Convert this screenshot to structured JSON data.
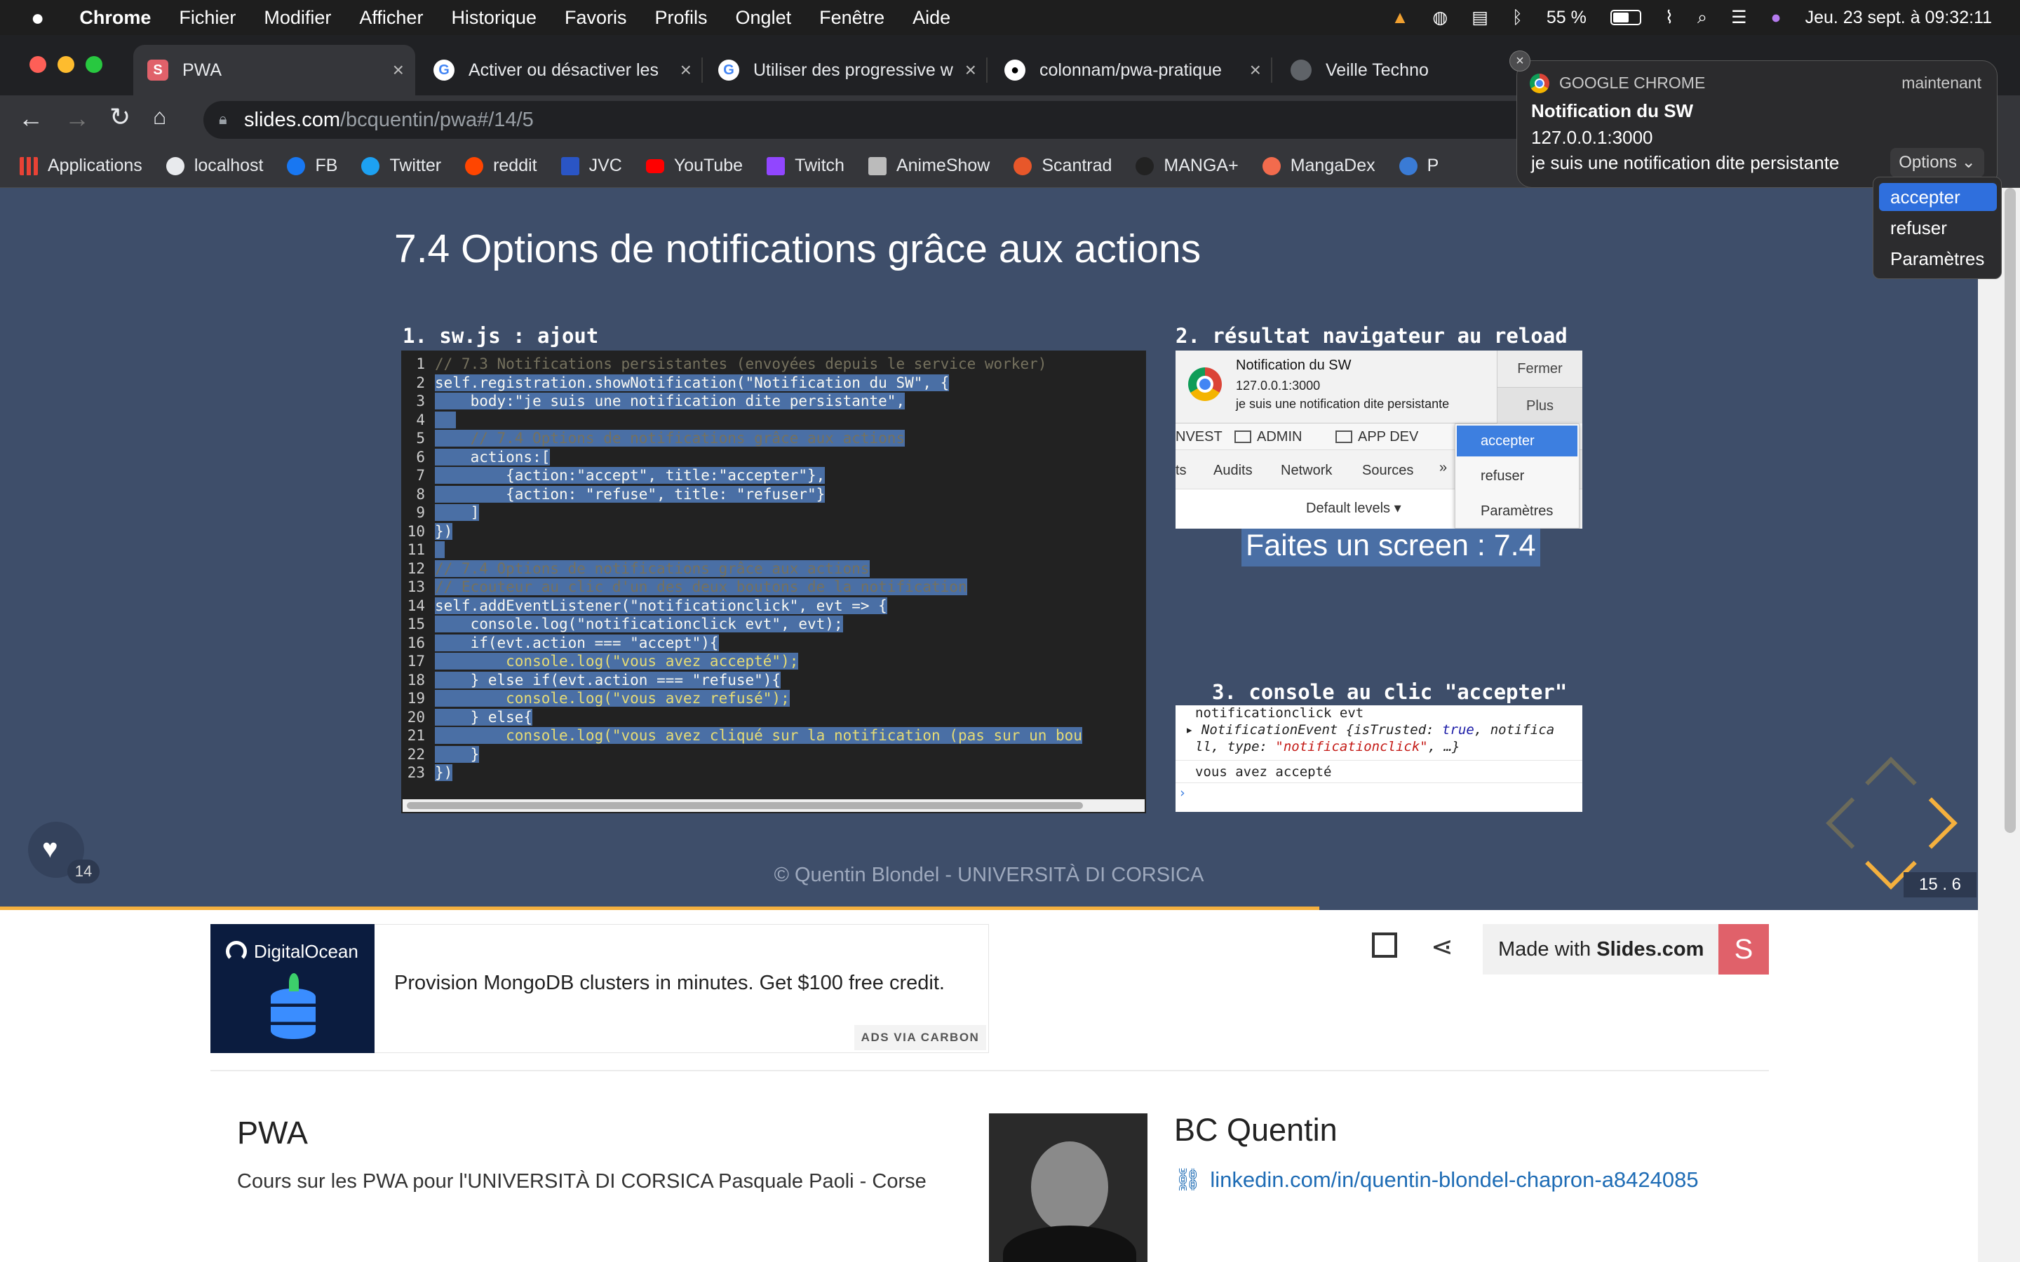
{
  "menubar": {
    "app": "Chrome",
    "items": [
      "Fichier",
      "Modifier",
      "Afficher",
      "Historique",
      "Favoris",
      "Profils",
      "Onglet",
      "Fenêtre",
      "Aide"
    ],
    "battery": "55 %",
    "datetime": "Jeu. 23 sept. à 09:32:11"
  },
  "tabs": [
    {
      "title": "PWA"
    },
    {
      "title": "Activer ou désactiver les"
    },
    {
      "title": "Utiliser des progressive w"
    },
    {
      "title": "colonnam/pwa-pratique"
    },
    {
      "title": "Veille Techno"
    }
  ],
  "address": {
    "host": "slides.com",
    "path": "/bcquentin/pwa#/14/5"
  },
  "bookmarks": [
    "Applications",
    "localhost",
    "FB",
    "Twitter",
    "reddit",
    "JVC",
    "YouTube",
    "Twitch",
    "AnimeShow",
    "Scantrad",
    "MANGA+",
    "MangaDex",
    "P"
  ],
  "slide": {
    "title": "7.4 Options de notifications grâce aux actions",
    "caption1": "1. sw.js : ajout",
    "caption2": "2. résultat navigateur au reload",
    "caption3": "3. console au clic \"accepter\"",
    "screen_label": "Faites un screen : 7.4",
    "footer": "© Quentin Blondel - UNIVERSITÀ DI CORSICA",
    "likes": "14",
    "page": "15 . 6",
    "progress": 0.667
  },
  "code_lines": [
    "// 7.3 Notifications persistantes (envoyées depuis le service worker)",
    "self.registration.showNotification(\"Notification du SW\", {",
    "    body:\"je suis une notification dite persistante\",",
    "",
    "    // 7.4 Options de notifications grâce aux actions",
    "    actions:[",
    "        {action:\"accept\", title:\"accepter\"},",
    "        {action: \"refuse\", title: \"refuser\"}",
    "    ]",
    "})",
    "",
    "// 7.4 Options de notifications grâce aux actions",
    "// Ecouteur au clic d'un des deux boutons de la notification",
    "self.addEventListener(\"notificationclick\", evt => {",
    "    console.log(\"notificationclick evt\", evt);",
    "    if(evt.action === \"accept\"){",
    "        console.log(\"vous avez accepté\");",
    "    } else if(evt.action === \"refuse\"){",
    "        console.log(\"vous avez refusé\");",
    "    } else{",
    "        console.log(\"vous avez cliqué sur la notification (pas sur un bou",
    "    }",
    "})"
  ],
  "shot2": {
    "title": "Notification du SW",
    "origin": "127.0.0.1:3000",
    "body": "je suis une notification dite persistante",
    "close": "Fermer",
    "more": "Plus",
    "bookmarks": [
      "NVEST",
      "ADMIN",
      "APP DEV"
    ],
    "devtabs": [
      "ts",
      "Audits",
      "Network",
      "Sources",
      "»"
    ],
    "levels": "Default levels ▾",
    "menu": [
      "accepter",
      "refuser",
      "Paramètres"
    ]
  },
  "shot3": {
    "line1": "notificationclick evt",
    "line2a": "NotificationEvent {isTrusted: ",
    "line2b": "true",
    "line2c": ", notifica",
    "line3a": "ll, type: ",
    "line3b": "\"notificationclick\"",
    "line3c": ", …}",
    "line4": "vous avez accepté"
  },
  "ad": {
    "brand": "DigitalOcean",
    "text": "Provision MongoDB clusters in minutes. Get $100 free credit.",
    "via": "ADS VIA CARBON"
  },
  "madewith": {
    "prefix": "Made with ",
    "brand": "Slides.com",
    "logo": "S"
  },
  "deck": {
    "title": "PWA",
    "description": "Cours sur les PWA pour l'UNIVERSITÀ DI CORSICA Pasquale Paoli - Corse",
    "author": "BC Quentin",
    "link": "linkedin.com/in/quentin-blondel-chapron-a8424085"
  },
  "notification": {
    "app": "GOOGLE CHROME",
    "time": "maintenant",
    "title": "Notification du SW",
    "origin": "127.0.0.1:3000",
    "body": "je suis une notification dite persistante",
    "options": "Options ⌄",
    "menu": [
      "accepter",
      "refuser",
      "Paramètres"
    ]
  },
  "colors": {
    "slide_bg": "#3e4e6a",
    "accent": "#f4b03e",
    "selection": "#4a6fa5",
    "link": "#1e6cb5"
  }
}
